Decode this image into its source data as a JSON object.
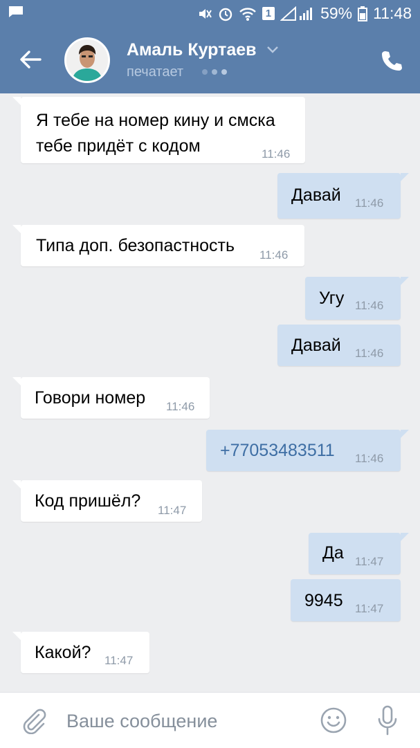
{
  "status_bar": {
    "battery_percent": "59%",
    "time": "11:48",
    "sim": "1"
  },
  "header": {
    "contact_name": "Амаль Куртаев",
    "status": "печатает"
  },
  "messages": [
    {
      "dir": "in",
      "lines": [
        "Я тебе на номер кину и смска",
        "тебе придёт с кодом"
      ],
      "time": "11:46"
    },
    {
      "dir": "out",
      "text": "Давай",
      "time": "11:46"
    },
    {
      "dir": "in",
      "text": "Типа доп. безопастность",
      "time": "11:46"
    },
    {
      "dir": "out",
      "text": "Угу",
      "time": "11:46"
    },
    {
      "dir": "out",
      "text": "Давай",
      "time": "11:46"
    },
    {
      "dir": "in",
      "text": "Говори номер",
      "time": "11:46"
    },
    {
      "dir": "out",
      "text": "+77053483511",
      "time": "11:46",
      "link": true
    },
    {
      "dir": "in",
      "text": "Код пришёл?",
      "time": "11:47"
    },
    {
      "dir": "out",
      "text": "Да",
      "time": "11:47"
    },
    {
      "dir": "out",
      "text": "9945",
      "time": "11:47"
    },
    {
      "dir": "in",
      "text": "Какой?",
      "time": "11:47"
    }
  ],
  "input": {
    "placeholder": "Ваше сообщение"
  },
  "colors": {
    "header": "#5b7fab",
    "chat_background": "#edeef0",
    "incoming_bubble": "#ffffff",
    "outgoing_bubble": "#cfdff1",
    "link": "#3e6ea4"
  }
}
